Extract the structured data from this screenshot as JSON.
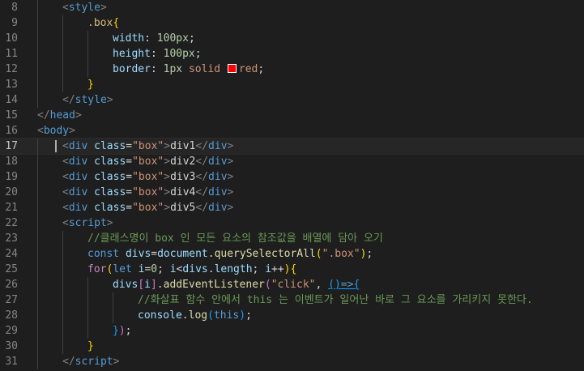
{
  "editor": {
    "colors": {
      "background": "#1e1e1e",
      "tag": "#808080",
      "keyword": "#569cd6",
      "attribute": "#9cdcfe",
      "string": "#ce9178",
      "comment": "#6a9955",
      "function": "#dcdcaa",
      "swatch_red": "#ff0000"
    },
    "active_line": 17,
    "lines": [
      {
        "n": 8,
        "indent": 1,
        "tokens": [
          [
            "t-tag",
            "<"
          ],
          [
            "t-name",
            "style"
          ],
          [
            "t-tag",
            ">"
          ]
        ]
      },
      {
        "n": 9,
        "indent": 2,
        "tokens": [
          [
            "t-sel",
            ".box"
          ],
          [
            "t-b1",
            "{"
          ]
        ]
      },
      {
        "n": 10,
        "indent": 3,
        "tokens": [
          [
            "t-prop",
            "width"
          ],
          [
            "t-text",
            ": "
          ],
          [
            "t-num",
            "100px"
          ],
          [
            "t-text",
            ";"
          ]
        ]
      },
      {
        "n": 11,
        "indent": 3,
        "tokens": [
          [
            "t-prop",
            "height"
          ],
          [
            "t-text",
            ": "
          ],
          [
            "t-num",
            "100px"
          ],
          [
            "t-text",
            ";"
          ]
        ]
      },
      {
        "n": 12,
        "indent": 3,
        "tokens": [
          [
            "t-prop",
            "border"
          ],
          [
            "t-text",
            ": "
          ],
          [
            "t-num",
            "1px"
          ],
          [
            "t-text",
            " "
          ],
          [
            "t-str",
            "solid"
          ],
          [
            "t-text",
            " "
          ],
          [
            "swatch",
            ""
          ],
          [
            "t-str",
            "red"
          ],
          [
            "t-text",
            ";"
          ]
        ]
      },
      {
        "n": 13,
        "indent": 2,
        "tokens": [
          [
            "t-b1",
            "}"
          ]
        ]
      },
      {
        "n": 14,
        "indent": 1,
        "tokens": [
          [
            "t-tag",
            "</"
          ],
          [
            "t-name",
            "style"
          ],
          [
            "t-tag",
            ">"
          ]
        ]
      },
      {
        "n": 15,
        "indent": 0,
        "tokens": [
          [
            "t-tag",
            "</"
          ],
          [
            "t-name",
            "head"
          ],
          [
            "t-tag",
            ">"
          ]
        ]
      },
      {
        "n": 16,
        "indent": 0,
        "tokens": [
          [
            "t-tag",
            "<"
          ],
          [
            "t-name",
            "body"
          ],
          [
            "t-tag",
            ">"
          ]
        ]
      },
      {
        "n": 17,
        "indent": 1,
        "tokens": [
          [
            "t-tag",
            "<"
          ],
          [
            "t-name",
            "div"
          ],
          [
            "t-text",
            " "
          ],
          [
            "t-attr",
            "class"
          ],
          [
            "t-text",
            "="
          ],
          [
            "t-str",
            "\"box\""
          ],
          [
            "t-tag",
            ">"
          ],
          [
            "t-text",
            "div1"
          ],
          [
            "t-tag",
            "</"
          ],
          [
            "t-name",
            "div"
          ],
          [
            "t-tag",
            ">"
          ]
        ]
      },
      {
        "n": 18,
        "indent": 1,
        "tokens": [
          [
            "t-tag",
            "<"
          ],
          [
            "t-name",
            "div"
          ],
          [
            "t-text",
            " "
          ],
          [
            "t-attr",
            "class"
          ],
          [
            "t-text",
            "="
          ],
          [
            "t-str",
            "\"box\""
          ],
          [
            "t-tag",
            ">"
          ],
          [
            "t-text",
            "div2"
          ],
          [
            "t-tag",
            "</"
          ],
          [
            "t-name",
            "div"
          ],
          [
            "t-tag",
            ">"
          ]
        ]
      },
      {
        "n": 19,
        "indent": 1,
        "tokens": [
          [
            "t-tag",
            "<"
          ],
          [
            "t-name",
            "div"
          ],
          [
            "t-text",
            " "
          ],
          [
            "t-attr",
            "class"
          ],
          [
            "t-text",
            "="
          ],
          [
            "t-str",
            "\"box\""
          ],
          [
            "t-tag",
            ">"
          ],
          [
            "t-text",
            "div3"
          ],
          [
            "t-tag",
            "</"
          ],
          [
            "t-name",
            "div"
          ],
          [
            "t-tag",
            ">"
          ]
        ]
      },
      {
        "n": 20,
        "indent": 1,
        "tokens": [
          [
            "t-tag",
            "<"
          ],
          [
            "t-name",
            "div"
          ],
          [
            "t-text",
            " "
          ],
          [
            "t-attr",
            "class"
          ],
          [
            "t-text",
            "="
          ],
          [
            "t-str",
            "\"box\""
          ],
          [
            "t-tag",
            ">"
          ],
          [
            "t-text",
            "div4"
          ],
          [
            "t-tag",
            "</"
          ],
          [
            "t-name",
            "div"
          ],
          [
            "t-tag",
            ">"
          ]
        ]
      },
      {
        "n": 21,
        "indent": 1,
        "tokens": [
          [
            "t-tag",
            "<"
          ],
          [
            "t-name",
            "div"
          ],
          [
            "t-text",
            " "
          ],
          [
            "t-attr",
            "class"
          ],
          [
            "t-text",
            "="
          ],
          [
            "t-str",
            "\"box\""
          ],
          [
            "t-tag",
            ">"
          ],
          [
            "t-text",
            "div5"
          ],
          [
            "t-tag",
            "</"
          ],
          [
            "t-name",
            "div"
          ],
          [
            "t-tag",
            ">"
          ]
        ]
      },
      {
        "n": 22,
        "indent": 1,
        "tokens": [
          [
            "t-tag",
            "<"
          ],
          [
            "t-name",
            "script"
          ],
          [
            "t-tag",
            ">"
          ]
        ]
      },
      {
        "n": 23,
        "indent": 2,
        "tokens": [
          [
            "t-com",
            "//클래스명이 box 인 모든 요소의 참조값을 배열에 담아 오기"
          ]
        ]
      },
      {
        "n": 24,
        "indent": 2,
        "tokens": [
          [
            "t-kw",
            "const"
          ],
          [
            "t-text",
            " "
          ],
          [
            "t-var",
            "divs"
          ],
          [
            "t-text",
            "="
          ],
          [
            "t-var",
            "document"
          ],
          [
            "t-text",
            "."
          ],
          [
            "t-fn",
            "querySelectorAll"
          ],
          [
            "t-b1",
            "("
          ],
          [
            "t-str",
            "\".box\""
          ],
          [
            "t-b1",
            ")"
          ],
          [
            "t-text",
            ";"
          ]
        ]
      },
      {
        "n": 25,
        "indent": 2,
        "tokens": [
          [
            "t-ctrl",
            "for"
          ],
          [
            "t-b1",
            "("
          ],
          [
            "t-kw",
            "let"
          ],
          [
            "t-text",
            " "
          ],
          [
            "t-var",
            "i"
          ],
          [
            "t-text",
            "="
          ],
          [
            "t-num",
            "0"
          ],
          [
            "t-text",
            "; "
          ],
          [
            "t-var",
            "i"
          ],
          [
            "t-text",
            "<"
          ],
          [
            "t-var",
            "divs"
          ],
          [
            "t-text",
            "."
          ],
          [
            "t-var",
            "length"
          ],
          [
            "t-text",
            "; "
          ],
          [
            "t-var",
            "i"
          ],
          [
            "t-text",
            "++"
          ],
          [
            "t-b1",
            ")"
          ],
          [
            "t-b1",
            "{"
          ]
        ]
      },
      {
        "n": 26,
        "indent": 3,
        "tokens": [
          [
            "t-var",
            "divs"
          ],
          [
            "t-b2",
            "["
          ],
          [
            "t-var",
            "i"
          ],
          [
            "t-b2",
            "]"
          ],
          [
            "t-text",
            "."
          ],
          [
            "t-fn",
            "addEventListener"
          ],
          [
            "t-b2",
            "("
          ],
          [
            "t-str",
            "\"click\""
          ],
          [
            "t-text",
            ", "
          ],
          [
            "t-b3 t-under",
            "()"
          ],
          [
            "t-kw t-under",
            "=>"
          ],
          [
            "t-b3 t-under",
            "{"
          ]
        ]
      },
      {
        "n": 27,
        "indent": 4,
        "tokens": [
          [
            "t-com",
            "//화살표 함수 안에서 this 는 이벤트가 일어난 바로 그 요소를 가리키지 못한다."
          ]
        ]
      },
      {
        "n": 28,
        "indent": 4,
        "tokens": [
          [
            "t-var",
            "console"
          ],
          [
            "t-text",
            "."
          ],
          [
            "t-fn",
            "log"
          ],
          [
            "t-b3",
            "("
          ],
          [
            "t-kw",
            "this"
          ],
          [
            "t-b3",
            ")"
          ],
          [
            "t-text",
            ";"
          ]
        ]
      },
      {
        "n": 29,
        "indent": 3,
        "tokens": [
          [
            "t-b3",
            "}"
          ],
          [
            "t-b2",
            ")"
          ],
          [
            "t-text",
            ";"
          ]
        ]
      },
      {
        "n": 30,
        "indent": 2,
        "tokens": [
          [
            "t-b1",
            "}"
          ]
        ]
      },
      {
        "n": 31,
        "indent": 1,
        "tokens": [
          [
            "t-tag",
            "</"
          ],
          [
            "t-name",
            "script"
          ],
          [
            "t-tag",
            ">"
          ]
        ]
      }
    ]
  }
}
